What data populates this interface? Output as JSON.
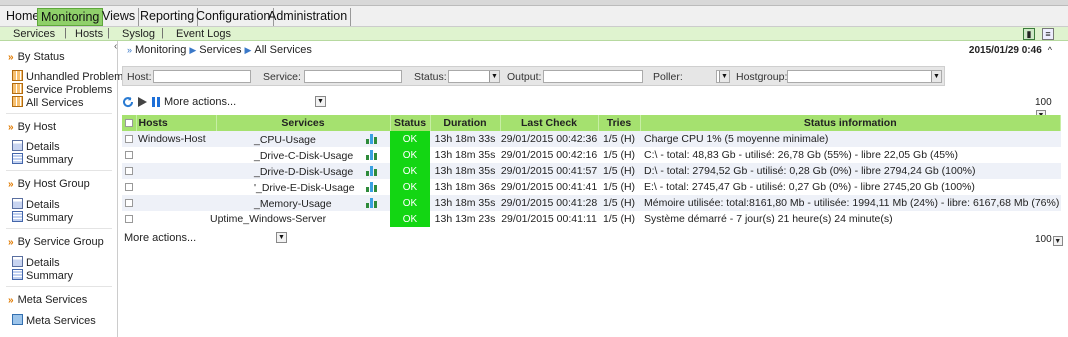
{
  "main_menu": [
    "Home",
    "Monitoring",
    "Views",
    "Reporting",
    "Configuration",
    "Administration"
  ],
  "active_menu": "Monitoring",
  "sub_menu": [
    "Services",
    "Hosts",
    "Syslog",
    "Event Logs"
  ],
  "sidebar": {
    "by_status": "By Status",
    "status_items": [
      "Unhandled Problems",
      "Service Problems",
      "All Services"
    ],
    "by_host": "By Host",
    "host_items": [
      "Details",
      "Summary"
    ],
    "by_host_group": "By Host Group",
    "host_group_items": [
      "Details",
      "Summary"
    ],
    "by_service_group": "By Service Group",
    "service_group_items": [
      "Details",
      "Summary"
    ],
    "meta": "Meta Services",
    "meta_item": "Meta Services"
  },
  "breadcrumb": [
    "Monitoring",
    "Services",
    "All Services"
  ],
  "datetime": "2015/01/29 0:46",
  "filters": {
    "host": "Host:",
    "service": "Service:",
    "status": "Status:",
    "output": "Output:",
    "poller": "Poller:",
    "hostgroup": "Hostgroup:"
  },
  "more_actions": "More actions...",
  "page_size": "100",
  "table": {
    "headers": [
      "Hosts",
      "Services",
      "Status",
      "Duration",
      "Last Check",
      "Tries",
      "Status information"
    ],
    "rows": [
      {
        "host": "Windows-Host",
        "service": "_CPU-Usage",
        "graph": true,
        "status": "OK",
        "duration": "13h 18m 33s",
        "last_check": "29/01/2015 00:42:36",
        "tries": "1/5 (H)",
        "info": "Charge CPU 1% (5 moyenne minimale)"
      },
      {
        "host": "",
        "service": "_Drive-C-Disk-Usage",
        "graph": true,
        "status": "OK",
        "duration": "13h 18m 35s",
        "last_check": "29/01/2015 00:42:16",
        "tries": "1/5 (H)",
        "info": "C:\\ - total: 48,83 Gb - utilisé: 26,78 Gb (55%) - libre 22,05 Gb (45%)"
      },
      {
        "host": "",
        "service": "_Drive-D-Disk-Usage",
        "graph": true,
        "status": "OK",
        "duration": "13h 18m 35s",
        "last_check": "29/01/2015 00:41:57",
        "tries": "1/5 (H)",
        "info": "D:\\ - total: 2794,52 Gb - utilisé: 0,28 Gb (0%) - libre 2794,24 Gb (100%)"
      },
      {
        "host": "",
        "service": "'_Drive-E-Disk-Usage",
        "graph": true,
        "status": "OK",
        "duration": "13h 18m 36s",
        "last_check": "29/01/2015 00:41:41",
        "tries": "1/5 (H)",
        "info": "E:\\ - total: 2745,47 Gb - utilisé: 0,27 Gb (0%) - libre 2745,20 Gb (100%)"
      },
      {
        "host": "",
        "service": "_Memory-Usage",
        "graph": true,
        "status": "OK",
        "duration": "13h 18m 35s",
        "last_check": "29/01/2015 00:41:28",
        "tries": "1/5 (H)",
        "info": "Mémoire utilisée: total:8161,80 Mb - utilisée: 1994,11 Mb (24%) - libre: 6167,68 Mb (76%)"
      },
      {
        "host": "",
        "service": "Uptime_Windows-Server",
        "graph": false,
        "status": "OK",
        "duration": "13h 13m 23s",
        "last_check": "29/01/2015 00:41:11",
        "tries": "1/5 (H)",
        "info": "Système démarré - 7 jour(s) 21 heure(s) 24 minute(s)"
      }
    ]
  },
  "colors": {
    "menu_active": "#8fd06a",
    "header_green": "#a5e16f",
    "status_ok": "#13d613",
    "row_alt": "#eef1f8"
  }
}
